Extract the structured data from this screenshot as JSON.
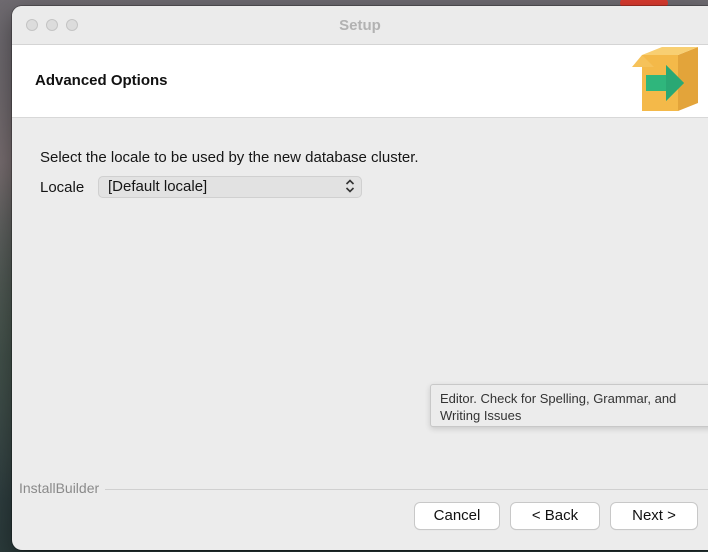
{
  "window": {
    "title": "Setup"
  },
  "header": {
    "title": "Advanced Options",
    "logo_icon": "install-box-arrow-icon"
  },
  "content": {
    "instruction": "Select the locale to be used by the new database cluster.",
    "locale": {
      "label": "Locale",
      "selected": "[Default locale]",
      "arrow_glyph": "⌃⌄"
    }
  },
  "tooltip": {
    "line1": "Editor. Check for Spelling, Grammar, and",
    "line2": "Writing Issues"
  },
  "footer": {
    "brand": "InstallBuilder",
    "cancel_label": "Cancel",
    "back_label": "< Back",
    "next_label": "Next >"
  },
  "colors": {
    "logo_box": "#f2b844",
    "logo_arrow": "#2fb67c",
    "window_bg": "#ececec"
  }
}
